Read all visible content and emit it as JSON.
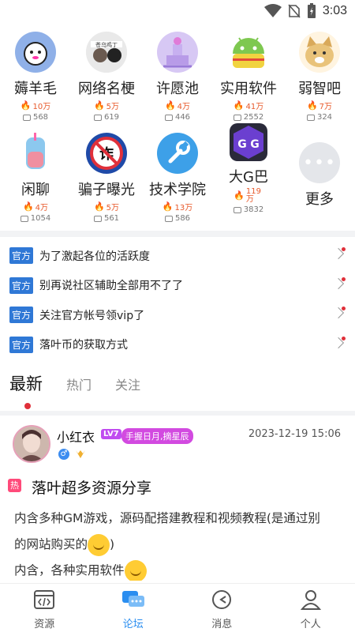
{
  "status": {
    "time": "3:03"
  },
  "forums": [
    {
      "name": "薅羊毛",
      "heat": "10万",
      "posts": "568",
      "icon": "sheep-icon"
    },
    {
      "name": "网络名梗",
      "heat": "5万",
      "posts": "619",
      "icon": "meme-icon"
    },
    {
      "name": "许愿池",
      "heat": "4万",
      "posts": "446",
      "icon": "fountain-icon"
    },
    {
      "name": "实用软件",
      "heat": "41万",
      "posts": "2552",
      "icon": "android-icon"
    },
    {
      "name": "弱智吧",
      "heat": "7万",
      "posts": "324",
      "icon": "doge-icon"
    },
    {
      "name": "闲聊",
      "heat": "4万",
      "posts": "1054",
      "icon": "drink-icon"
    },
    {
      "name": "骗子曝光",
      "heat": "5万",
      "posts": "561",
      "icon": "scam-icon"
    },
    {
      "name": "技术学院",
      "heat": "13万",
      "posts": "586",
      "icon": "wrench-icon"
    },
    {
      "name": "大G巴",
      "heat": "119万",
      "posts": "3832",
      "icon": "gg-icon"
    }
  ],
  "more_label": "更多",
  "notices": [
    {
      "tag": "官方",
      "text": "为了激起各位的活跃度"
    },
    {
      "tag": "官方",
      "text": "别再说社区辅助全部用不了了"
    },
    {
      "tag": "官方",
      "text": "关注官方帐号领vip了"
    },
    {
      "tag": "官方",
      "text": "落叶币的获取方式"
    }
  ],
  "tabs": {
    "latest": "最新",
    "hot": "热门",
    "follow": "关注"
  },
  "post": {
    "username": "小红衣",
    "level": "LV7",
    "title_badge": "手握日月,摘星辰",
    "time": "2023-12-19 15:06",
    "hot_tag": "热",
    "title": "落叶超多资源分享",
    "body_line1": "内含多种GM游戏，源码配搭建教程和视频教程(是通过别",
    "body_line2": "的网站购买的",
    "body_line2_end": ")",
    "body_line3": "内含，各种实用软件"
  },
  "nav": {
    "resources": "资源",
    "forum": "论坛",
    "messages": "消息",
    "profile": "个人"
  },
  "colors": {
    "accent": "#2b8ef0",
    "official": "#2f78d6",
    "hot": "#ff4a7a",
    "flame": "#ff6a1a"
  }
}
